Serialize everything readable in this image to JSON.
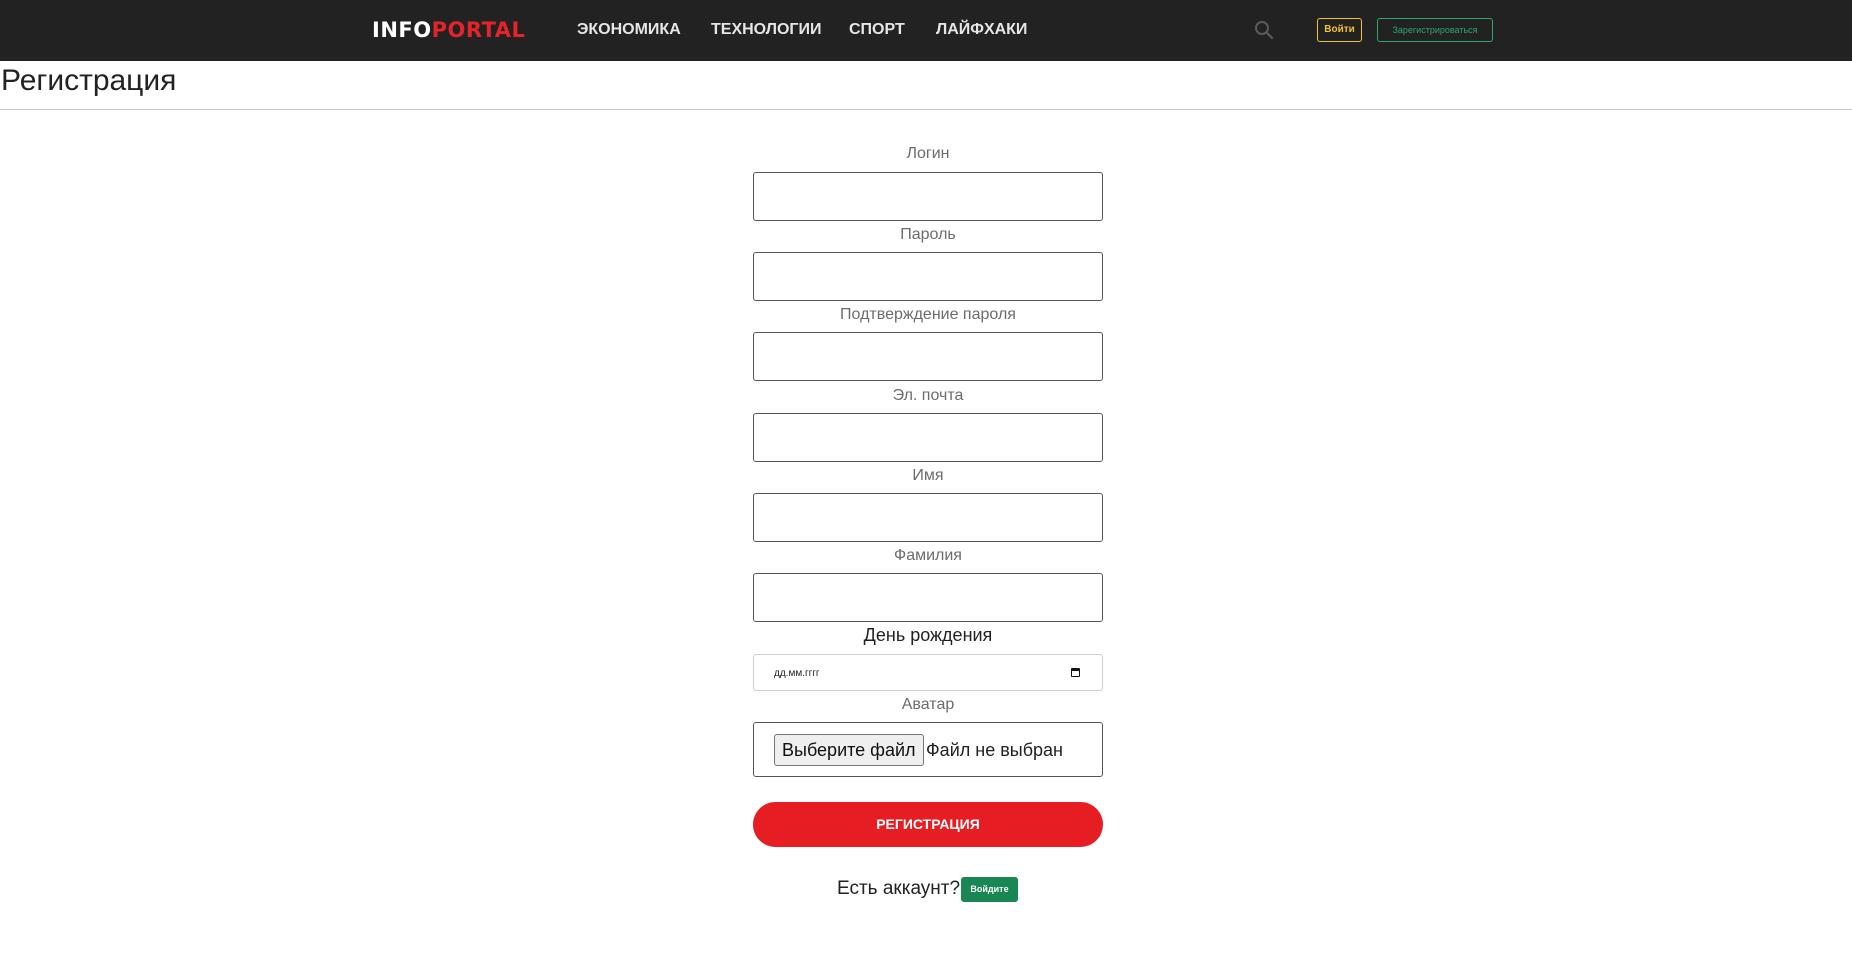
{
  "header": {
    "logo": {
      "part1": "INFO",
      "part2": "PORTAL"
    },
    "nav": [
      "ЭКОНОМИКА",
      "ТЕХНОЛОГИИ",
      "СПОРТ",
      "ЛАЙФХАКИ"
    ],
    "search_icon": "search-icon",
    "login_label": "Войти",
    "register_label": "Зарегистрироваться"
  },
  "page": {
    "title": "Регистрация"
  },
  "form": {
    "login_label": "Логин",
    "login_value": "",
    "password_label": "Пароль",
    "password_value": "",
    "confirm_label": "Подтверждение пароля",
    "confirm_value": "",
    "email_label": "Эл. почта",
    "email_value": "",
    "name_label": "Имя",
    "name_value": "",
    "surname_label": "Фамилия",
    "surname_value": "",
    "birthday_label": "День рождения",
    "birthday_placeholder": "дд.мм.гггг",
    "avatar_label": "Аватар",
    "file_button": "Выберите файл",
    "file_status": "Файл не выбран",
    "submit": "РЕГИСТРАЦИЯ",
    "have_account": "Есть аккаунт?",
    "login_link": "Войдите"
  },
  "colors": {
    "navbar_bg": "#222222",
    "brand_red": "#e71d24",
    "login_yellow": "#f5c030",
    "register_green": "#2fa66c",
    "link_green": "#198754"
  }
}
